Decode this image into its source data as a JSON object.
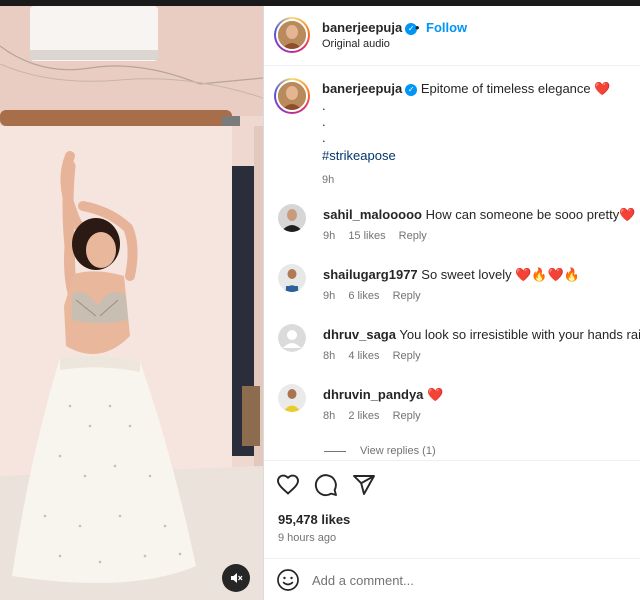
{
  "post": {
    "username": "banerjeepuja",
    "verified": true,
    "separator": "•",
    "follow_label": "Follow",
    "audio": "Original audio",
    "caption_text": "Epitome of timeless elegance",
    "caption_emoji": "❤️",
    "caption_dots": [
      ".",
      ".",
      "."
    ],
    "hashtag": "#strikeapose",
    "caption_time": "9h"
  },
  "comments": [
    {
      "username": "sahil_malooooo",
      "text": "How can someone be sooo pretty❤️",
      "time": "9h",
      "likes": "15 likes",
      "reply": "Reply"
    },
    {
      "username": "shailugarg1977",
      "text": "So sweet lovely ❤️🔥❤️🔥",
      "time": "9h",
      "likes": "6 likes",
      "reply": "Reply"
    },
    {
      "username": "dhruv_saga",
      "text": "You look so irresistible with your hands raised",
      "time": "8h",
      "likes": "4 likes",
      "reply": "Reply"
    },
    {
      "username": "dhruvin_pandya",
      "text": "❤️",
      "time": "8h",
      "likes": "2 likes",
      "reply": "Reply"
    }
  ],
  "view_replies": "View replies (1)",
  "actions": {
    "icons": [
      "heart-icon",
      "comment-icon",
      "share-icon"
    ],
    "likes": "95,478 likes",
    "ago": "9 hours ago"
  },
  "add_comment": {
    "placeholder": "Add a comment..."
  },
  "colors": {
    "link": "#0095f6",
    "hashtag": "#00376b",
    "muted": "#737373",
    "text": "#262626"
  }
}
